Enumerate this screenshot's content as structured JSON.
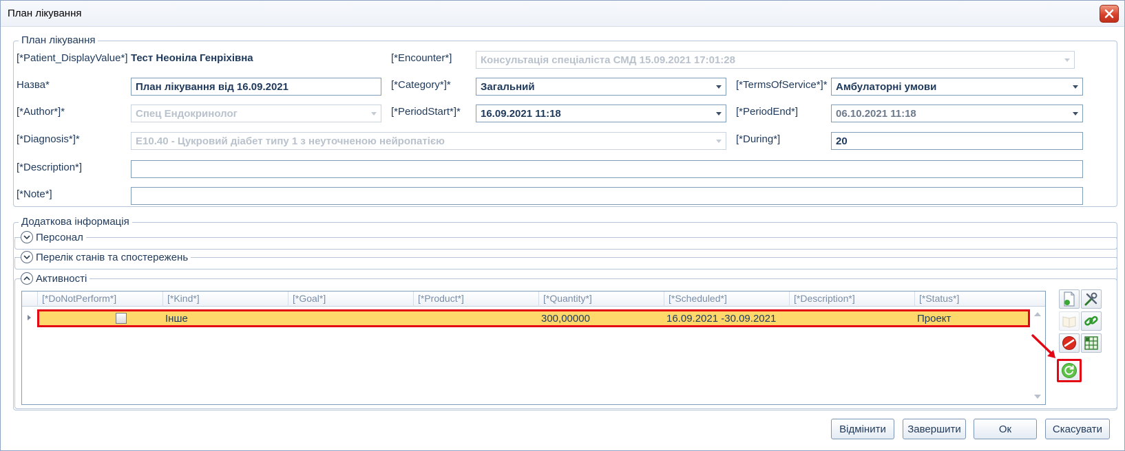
{
  "window": {
    "title": "План лікування"
  },
  "plan": {
    "caption": "План лікування",
    "patient": {
      "label": "[*Patient_DisplayValue*]",
      "value": "Тест Неоніла Генріхівна"
    },
    "encounter": {
      "label": "[*Encounter*]",
      "value": "Консультація спеціаліста СМД 15.09.2021 17:01:28"
    },
    "name": {
      "label": "Назва*",
      "value": "План лікування від 16.09.2021"
    },
    "category": {
      "label": "[*Category*]*",
      "value": "Загальний"
    },
    "terms": {
      "label": "[*TermsOfService*]*",
      "value": "Амбулаторні умови"
    },
    "author": {
      "label": "[*Author*]*",
      "value": "Спец Ендокринолог"
    },
    "period_start": {
      "label": "[*PeriodStart*]*",
      "value": "16.09.2021 11:18"
    },
    "period_end": {
      "label": "[*PeriodEnd*]",
      "value": "06.10.2021 11:18"
    },
    "diagnosis": {
      "label": "[*Diagnosis*]*",
      "value": "E10.40 - Цукровий діабет типу 1 з неуточненою нейропатією"
    },
    "during": {
      "label": "[*During*]",
      "value": "20"
    },
    "description": {
      "label": "[*Description*]",
      "value": ""
    },
    "note": {
      "label": "[*Note*]",
      "value": ""
    }
  },
  "additional": {
    "caption": "Додаткова інформація",
    "sections": [
      {
        "title": "Персонал",
        "expanded": false
      },
      {
        "title": "Перелік станів та спостережень",
        "expanded": false
      },
      {
        "title": "Активності",
        "expanded": true
      }
    ]
  },
  "activities": {
    "columns": [
      "[*DoNotPerform*]",
      "[*Kind*]",
      "[*Goal*]",
      "[*Product*]",
      "[*Quantity*]",
      "[*Scheduled*]",
      "[*Description*]",
      "[*Status*]"
    ],
    "rows": [
      {
        "do_not_perform": false,
        "kind": "Інше",
        "goal": "",
        "product": "",
        "quantity": "300,00000",
        "scheduled": "16.09.2021 -30.09.2021",
        "description": "",
        "status": "Проект"
      }
    ]
  },
  "toolbar_icons": [
    "new-document-icon",
    "tools-icon",
    "open-book-icon",
    "link-icon",
    "no-entry-icon",
    "grid-edit-icon",
    "refresh-icon"
  ],
  "buttons": {
    "undo": "Відмінити",
    "finish": "Завершити",
    "ok": "Ок",
    "cancel": "Скасувати"
  },
  "colors": {
    "highlight_border": "#e30613",
    "selected_row": "#fed86a",
    "label_text": "#1e395b"
  }
}
